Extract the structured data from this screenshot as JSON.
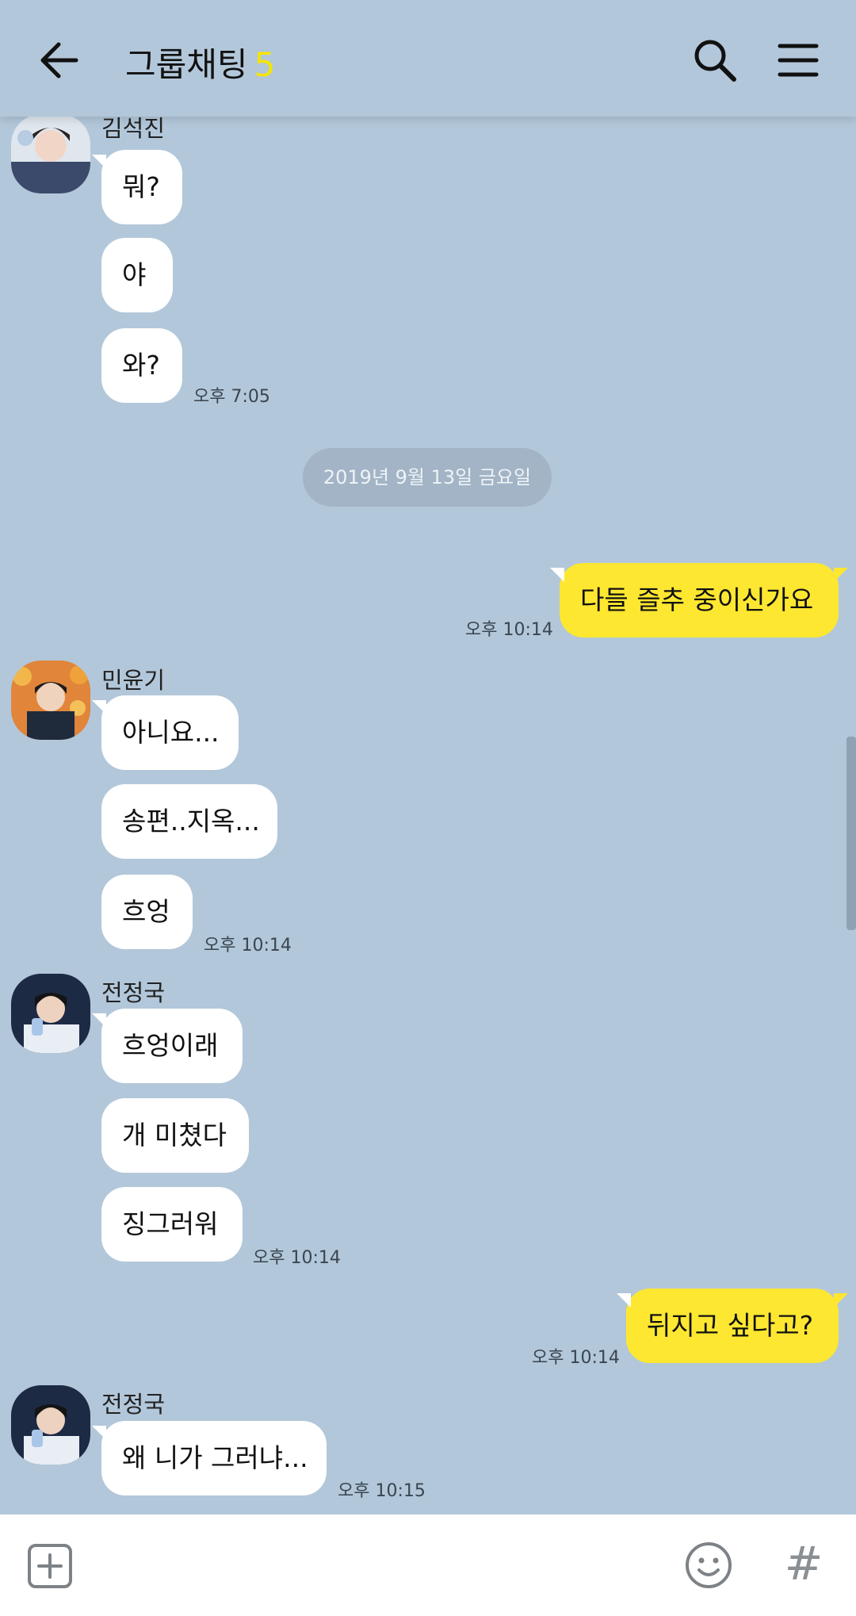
{
  "header": {
    "title": "그룹채팅",
    "member_count": "5",
    "back_icon": "arrow-left-icon",
    "search_icon": "search-icon",
    "menu_icon": "hamburger-menu-icon"
  },
  "date_divider": "2019년 9월 13일 금요일",
  "messages": {
    "m1": {
      "sender": "김석진",
      "text": "뭐?"
    },
    "m2": {
      "text": "야"
    },
    "m3": {
      "text": "와?",
      "time": "오후 7:05"
    },
    "m4": {
      "text": "다들 즐추 중이신가요",
      "time": "오후 10:14"
    },
    "m5": {
      "sender": "민윤기",
      "text": "아니요..."
    },
    "m6": {
      "text": "송편..지옥..."
    },
    "m7": {
      "text": "흐엉",
      "time": "오후 10:14"
    },
    "m8": {
      "sender": "전정국",
      "text": "흐엉이래"
    },
    "m9": {
      "text": "개 미쳤다"
    },
    "m10": {
      "text": "징그러워",
      "time": "오후 10:14"
    },
    "m11": {
      "text": "뒤지고 싶다고?",
      "time": "오후 10:14"
    },
    "m12": {
      "sender": "전정국",
      "text": "왜 니가 그러냐...",
      "time": "오후 10:15"
    }
  },
  "input": {
    "placeholder": "",
    "plus_icon": "plus-square-icon",
    "emoji_icon": "emoji-smile-icon",
    "hash_label": "#"
  },
  "colors": {
    "background": "#b2c7da",
    "my_bubble": "#fde731",
    "other_bubble": "#ffffff",
    "member_count": "#f5e500"
  }
}
